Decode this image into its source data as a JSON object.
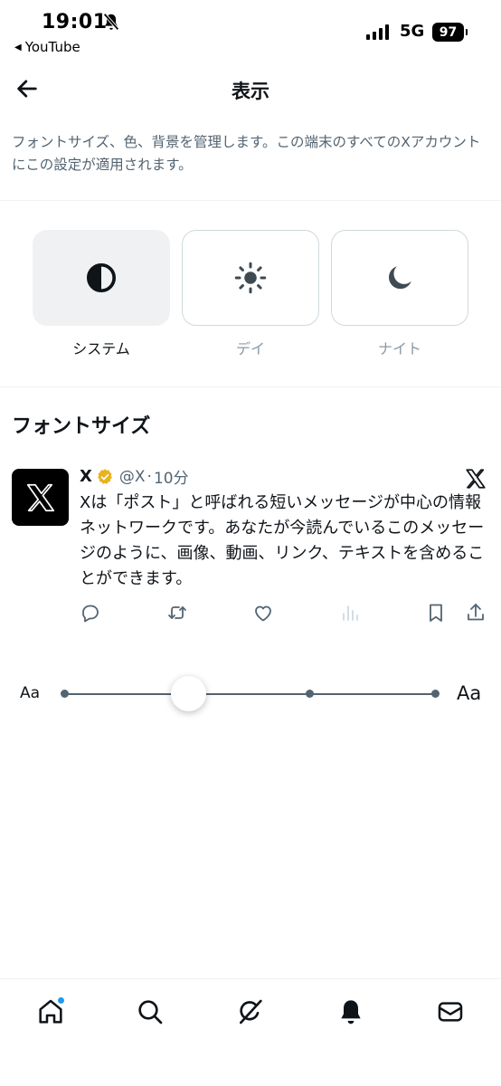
{
  "status_bar": {
    "time": "19:01",
    "back_app": "YouTube",
    "network": "5G",
    "battery": "97"
  },
  "header": {
    "title": "表示"
  },
  "description": "フォントサイズ、色、背景を管理します。この端末のすべてのXアカウントにこの設定が適用されます。",
  "theme": {
    "options": [
      {
        "label": "システム",
        "icon": "half-circle-icon",
        "selected": true
      },
      {
        "label": "デイ",
        "icon": "sun-icon",
        "selected": false
      },
      {
        "label": "ナイト",
        "icon": "moon-icon",
        "selected": false
      }
    ]
  },
  "font_size": {
    "section_title": "フォントサイズ",
    "small_label": "Aa",
    "large_label": "Aa",
    "steps": 5,
    "selected_step": 2
  },
  "post": {
    "author": "X",
    "handle": "@X",
    "separator": "·",
    "time": "10分",
    "text": "Xは「ポスト」と呼ばれる短いメッセージが中心の情報ネットワークです。あなたが今読んでいるこのメッセージのように、画像、動画、リンク、テキストを含めることができます。"
  },
  "colors": {
    "accent": "#1d9bf0",
    "verified": "#e8b221",
    "secondary_text": "#536471"
  }
}
